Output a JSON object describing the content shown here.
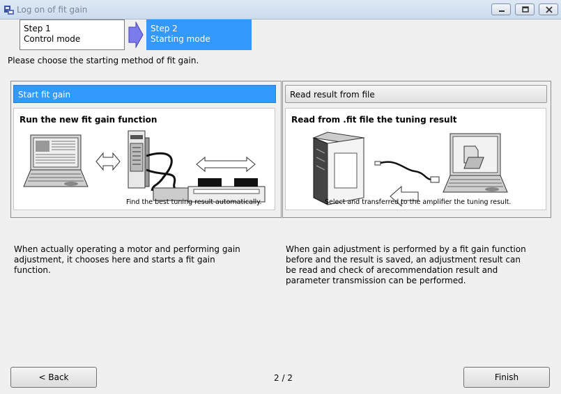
{
  "window": {
    "title": "Log on of fit gain"
  },
  "steps": [
    {
      "line1": "Step 1",
      "line2": "Control mode"
    },
    {
      "line1": "Step 2",
      "line2": "Starting mode"
    }
  ],
  "instruction": "Please choose the starting method of fit gain.",
  "panels": {
    "left": {
      "header": "Start fit gain",
      "title": "Run the new fit gain function",
      "caption": "Find the best tuning result automatically.",
      "description": "When actually operating a motor and performing gain adjustment, it chooses here and starts a fit gain function."
    },
    "right": {
      "header": "Read result from file",
      "title": "Read from .fit file the tuning result",
      "caption": "Select and transferred to the amplifier the tuning result.",
      "description": "When gain adjustment is performed by a fit gain function before and the result is saved, an adjustment result can be read and check of arecommendation result and parameter transmission can be performed."
    }
  },
  "footer": {
    "back_label": "< Back",
    "page": "2 / 2",
    "finish_label": "Finish"
  },
  "colors": {
    "accent": "#3399ff"
  }
}
